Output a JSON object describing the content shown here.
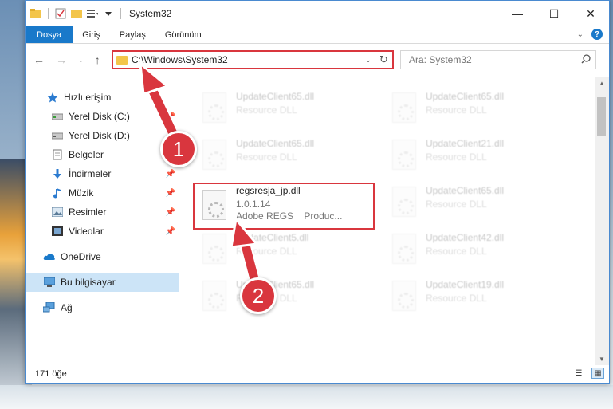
{
  "window": {
    "title": "System32"
  },
  "ribbon": {
    "tabs": [
      "Dosya",
      "Giriş",
      "Paylaş",
      "Görünüm"
    ]
  },
  "address": {
    "path": "C:\\Windows\\System32"
  },
  "search": {
    "placeholder": "Ara: System32"
  },
  "sidebar": {
    "items": [
      {
        "label": "Hızlı erişim",
        "icon": "star-icon"
      },
      {
        "label": "Yerel Disk (C:)",
        "icon": "drive-icon",
        "pinned": true
      },
      {
        "label": "Yerel Disk (D:)",
        "icon": "drive-icon"
      },
      {
        "label": "Belgeler",
        "icon": "documents-icon"
      },
      {
        "label": "İndirmeler",
        "icon": "download-icon",
        "pinned": true
      },
      {
        "label": "Müzik",
        "icon": "music-icon",
        "pinned": true
      },
      {
        "label": "Resimler",
        "icon": "pictures-icon",
        "pinned": true
      },
      {
        "label": "Videolar",
        "icon": "video-icon",
        "pinned": true
      },
      {
        "label": "OneDrive",
        "icon": "cloud-icon"
      },
      {
        "label": "Bu bilgisayar",
        "icon": "computer-icon",
        "selected": true
      },
      {
        "label": "Ağ",
        "icon": "network-icon"
      }
    ]
  },
  "files": {
    "left": [
      {
        "name": "UpdateClient65.dll",
        "sub": "Resource DLL"
      },
      {
        "name": "UpdateClient65.dll",
        "sub": "Resource DLL"
      },
      {
        "name": "regsresja_jp.dll",
        "version": "1.0.1.14",
        "company": "Adobe REGS",
        "product": "Produc..."
      },
      {
        "name": "UpdateClient5.dll",
        "sub": "Resource DLL"
      },
      {
        "name": "UpdateClient65.dll",
        "sub": "Resource DLL"
      }
    ],
    "right": [
      {
        "name": "UpdateClient65.dll",
        "sub": "Resource DLL"
      },
      {
        "name": "UpdateClient21.dll",
        "sub": "Resource DLL"
      },
      {
        "name": "UpdateClient65.dll",
        "sub": "Resource DLL"
      },
      {
        "name": "UpdateClient42.dll",
        "sub": "Resource DLL"
      },
      {
        "name": "UpdateClient19.dll",
        "sub": "Resource DLL"
      }
    ]
  },
  "status": {
    "count": "171 öğe"
  },
  "annotations": {
    "badge1": "1",
    "badge2": "2",
    "accent_color": "#d9363e"
  }
}
